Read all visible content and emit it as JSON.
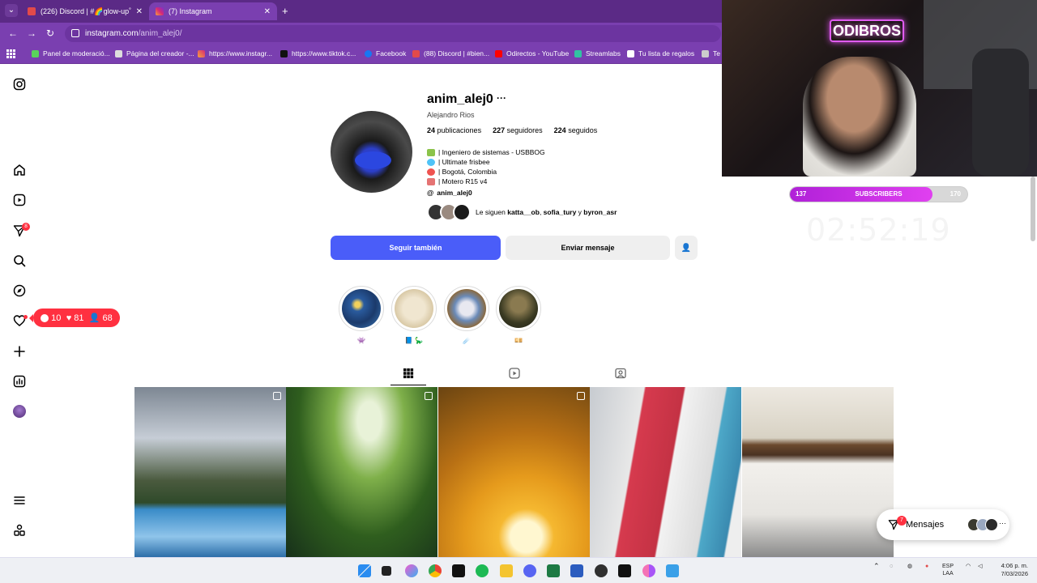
{
  "browser": {
    "tabs": [
      {
        "title": "(226) Discord | #​🌈glow-up˚",
        "active": false
      },
      {
        "title": "(7) Instagram",
        "active": true
      }
    ],
    "url_host": "instagram.com",
    "url_path": "/anim_alej0/",
    "bookmarks": [
      "Panel de moderació...",
      "Página del creador -...",
      "https://www.instagr...",
      "https://www.tiktok.c...",
      "Facebook",
      "(88) Discord | #bien...",
      "Odirectos - YouTube",
      "Streamlabs",
      "Tu lista de regalos",
      "Te c"
    ]
  },
  "sidebar": {
    "icons": [
      "instagram-icon",
      "home-icon",
      "reels-icon",
      "direct-icon",
      "search-icon",
      "explore-icon",
      "heart-icon",
      "create-icon",
      "insights-icon",
      "profile-avatar",
      "menu-icon",
      "meta-icon"
    ],
    "direct_badge": "8"
  },
  "notifications_pill": {
    "comments": "10",
    "likes": "81",
    "follows": "68"
  },
  "profile": {
    "username": "anim_alej0",
    "more": "···",
    "full_name": "Alejandro Rios",
    "posts_count": "24",
    "posts_label": "publicaciones",
    "followers_count": "227",
    "followers_label": "seguidores",
    "following_count": "224",
    "following_label": "seguidos",
    "bio": [
      "| Ingeniero de sistemas - USBBOG",
      "| Ultimate frisbee",
      "| Bogotá, Colombia",
      "| Motero R15 v4"
    ],
    "threads_handle": "anim_alej0",
    "followed_by_prefix": "Le siguen",
    "followed_by_1": "katta__ob",
    "followed_by_2": "sofia_tury",
    "followed_by_sep": "y",
    "followed_by_3": "byron_asr",
    "follow_button": "Seguir también",
    "message_button": "Enviar mensaje"
  },
  "highlights": [
    {
      "label": "👾"
    },
    {
      "label": "📘 🦕"
    },
    {
      "label": "☄️"
    },
    {
      "label": "💴"
    }
  ],
  "colors": {
    "browser_frame": "#7a3fb0",
    "tabstrip": "#5b2a86",
    "follow_blue": "#4a5df9",
    "notif_red": "#ff3040",
    "sub_bar_fill": "#c030e0"
  },
  "messages": {
    "label": "Mensajes",
    "count": "7"
  },
  "stream_overlay": {
    "sign_text": "ODIBROS",
    "subs_current": "137",
    "subs_label": "SUBSCRIBERS",
    "subs_goal": "170",
    "timer": "02:52:19"
  },
  "taskbar": {
    "lang_1": "ESP",
    "lang_2": "LAA",
    "time": "4:06 p. m.",
    "date": "7/03/2026"
  }
}
